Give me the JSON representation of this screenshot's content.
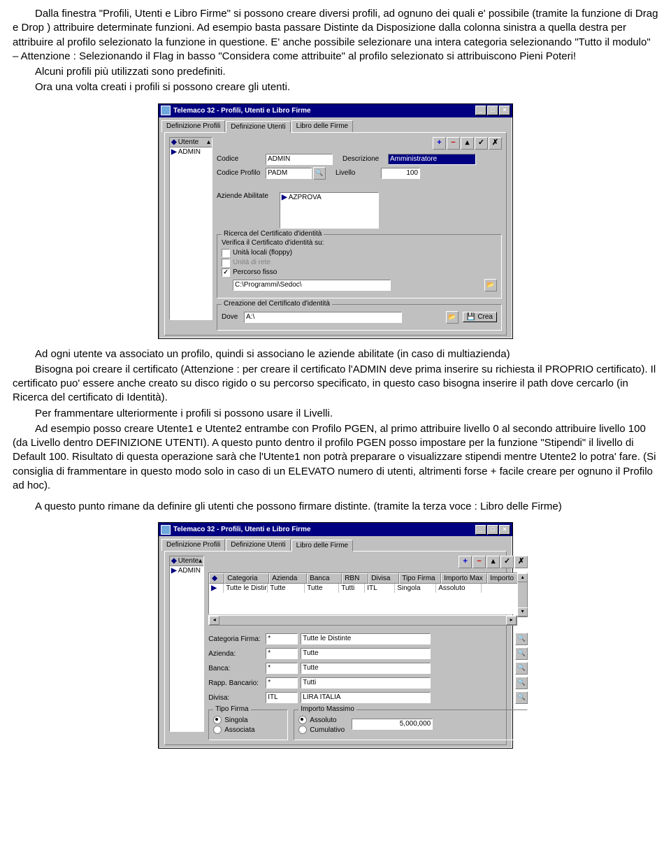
{
  "para1": "Dalla finestra \"Profili, Utenti e Libro Firme\" si possono creare diversi profili, ad ognuno dei quali e' possibile (tramite la funzione di Drag e Drop ) attribuire determinate funzioni. Ad esempio basta passare Distinte da Disposizione dalla colonna sinistra a quella destra per attribuire al profilo selezionato la funzione in questione. E' anche possibile selezionare una intera categoria selezionando \"Tutto il modulo\" – Attenzione : Selezionando il Flag in basso \"Considera come attribuite\" al profilo selezionato si attribuiscono Pieni Poteri!",
  "para1b": "Alcuni profili più utilizzati sono predefiniti.",
  "para1c": "Ora una volta creati i profili si possono creare gli utenti.",
  "mid1": "Ad ogni utente va associato un profilo, quindi si associano le aziende abilitate (in caso di multiazienda)",
  "mid2": "Bisogna poi creare il certificato (Attenzione : per creare il certificato l'ADMIN deve prima inserire su richiesta il PROPRIO certificato). Il certificato puo' essere anche creato su disco rigido o su percorso specificato, in questo caso bisogna inserire il path dove cercarlo (in Ricerca del certificato di Identità).",
  "mid3": "Per frammentare ulteriormente i profili si possono usare il Livelli.",
  "mid4": "Ad esempio posso creare Utente1 e Utente2 entrambe con Profilo PGEN, al primo attribuire livello 0 al secondo attribuire livello 100 (da Livello dentro DEFINIZIONE UTENTI). A questo punto dentro il profilo PGEN posso impostare per la funzione \"Stipendi\" il livello di Default 100. Risultato di questa operazione sarà che l'Utente1 non potrà preparare o visualizzare stipendi mentre Utente2 lo potra' fare. (Si consiglia di frammentare in questo modo solo in caso di un ELEVATO numero di utenti, altrimenti forse + facile creare per ognuno il Profilo ad hoc).",
  "mid5": "A questo punto rimane da definire gli utenti che possono firmare distinte. (tramite la terza voce : Libro delle Firme)",
  "win1": {
    "title": "Telemaco 32 - Profili, Utenti e Libro Firme",
    "tabs": [
      "Definizione Profili",
      "Definizione Utenti",
      "Libro delle Firme"
    ],
    "activeTab": 1,
    "listHeader": "Utente",
    "listItem": "ADMIN",
    "codiceLbl": "Codice",
    "codiceVal": "ADMIN",
    "descrLbl": "Descrizione",
    "descrVal": "Amministratore",
    "codProfLbl": "Codice Profilo",
    "codProfVal": "PADM",
    "livelloLbl": "Livello",
    "livelloVal": "100",
    "aziendeLbl": "Aziende Abilitate",
    "aziendeVal": "AZPROVA",
    "grpRicerca": "Ricerca del Certificato d'identità",
    "verifica": "Verifica il Certificato d'identità su:",
    "chk1": "Unità locali (floppy)",
    "chk2": "Unità di rete",
    "chk3": "Percorso fisso",
    "percorsoVal": "C:\\Programmi\\Sedoc\\",
    "grpCrea": "Creazione del Certificato d'identità",
    "doveLbl": "Dove",
    "doveVal": "A:\\",
    "creaBtn": "Crea"
  },
  "win2": {
    "title": "Telemaco 32 - Profili, Utenti e Libro Firme",
    "tabs": [
      "Definizione Profili",
      "Definizione Utenti",
      "Libro delle Firme"
    ],
    "activeTab": 2,
    "listHeader": "Utente",
    "listItem": "ADMIN",
    "cols": [
      "Categoria",
      "Azienda",
      "Banca",
      "RBN",
      "Divisa",
      "Tipo Firma",
      "Importo Max",
      "Importo"
    ],
    "row": [
      "Tutte le Distin",
      "Tutte",
      "Tutte",
      "Tutti",
      "ITL",
      "Singola",
      "Assoluto",
      ""
    ],
    "catFirmaLbl": "Categoria Firma:",
    "catFirmaVal": "*",
    "catFirmaDesc": "Tutte le Distinte",
    "aziendaLbl": "Azienda:",
    "aziendaVal": "*",
    "aziendaDesc": "Tutte",
    "bancaLbl": "Banca:",
    "bancaVal": "*",
    "bancaDesc": "Tutte",
    "rappLbl": "Rapp. Bancario:",
    "rappVal": "*",
    "rappDesc": "Tutti",
    "divisaLbl": "Divisa:",
    "divisaVal": "ITL",
    "divisaDesc": "LIRA ITALIA",
    "grpTipo": "Tipo Firma",
    "rTipo1": "Singola",
    "rTipo2": "Associata",
    "grpImpMax": "Importo Massimo",
    "rImp1": "Assoluto",
    "rImp2": "Cumulativo",
    "impVal": "5,000,000"
  }
}
